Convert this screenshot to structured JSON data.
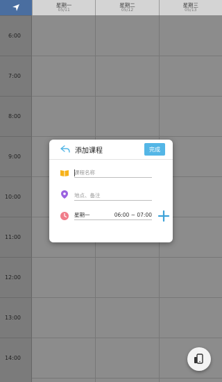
{
  "header": {
    "days": [
      {
        "name": "星期一",
        "date": "05/11"
      },
      {
        "name": "星期二",
        "date": "05/12"
      },
      {
        "name": "星期三",
        "date": "05/13"
      }
    ]
  },
  "times": [
    "6:00",
    "7:00",
    "8:00",
    "9:00",
    "10:00",
    "11:00",
    "12:00",
    "13:00",
    "14:00"
  ],
  "dialog": {
    "title": "添加课程",
    "done_label": "完成",
    "course_name_placeholder": "课程名称",
    "location_placeholder": "地点、备注",
    "weekday": "星期一",
    "time_range": "06:00 ~ 07:00"
  },
  "icons": {
    "corner": "location-arrow-icon",
    "back": "back-arrow-icon",
    "book": "book-icon",
    "location": "location-pin-icon",
    "clock": "clock-icon",
    "add": "plus-icon",
    "fab": "switch-device-icon"
  },
  "colors": {
    "accent": "#54b6e6",
    "book": "#f6b21a",
    "location": "#9b62e0",
    "clock": "#f07d8a",
    "corner": "#4a6ea0"
  }
}
